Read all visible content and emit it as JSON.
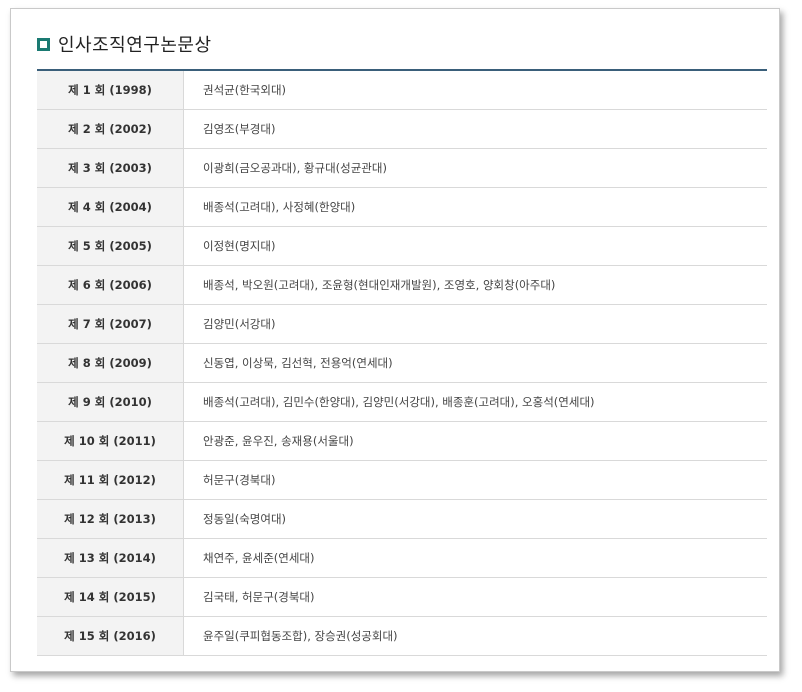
{
  "title": "인사조직연구논문상",
  "rows": [
    {
      "round": "제 1 회 (1998)",
      "winners": "권석균(한국외대)"
    },
    {
      "round": "제 2 회 (2002)",
      "winners": "김영조(부경대)"
    },
    {
      "round": "제 3 회 (2003)",
      "winners": "이광희(금오공과대), 황규대(성균관대)"
    },
    {
      "round": "제 4 회 (2004)",
      "winners": "배종석(고려대), 사정혜(한양대)"
    },
    {
      "round": "제 5 회 (2005)",
      "winners": "이정현(명지대)"
    },
    {
      "round": "제 6 회 (2006)",
      "winners": "배종석, 박오원(고려대), 조윤형(현대인재개발원), 조영호, 양회창(아주대)"
    },
    {
      "round": "제 7 회 (2007)",
      "winners": "김양민(서강대)"
    },
    {
      "round": "제 8 회 (2009)",
      "winners": "신동엽, 이상묵, 김선혁, 전용억(연세대)"
    },
    {
      "round": "제 9 회 (2010)",
      "winners": "배종석(고려대), 김민수(한양대), 김양민(서강대), 배종훈(고려대), 오홍석(연세대)"
    },
    {
      "round": "제 10 회 (2011)",
      "winners": "안광준, 윤우진, 송재용(서울대)"
    },
    {
      "round": "제 11 회 (2012)",
      "winners": "허문구(경북대)"
    },
    {
      "round": "제 12 회 (2013)",
      "winners": "정동일(숙명여대)"
    },
    {
      "round": "제 13 회 (2014)",
      "winners": "채연주, 윤세준(연세대)"
    },
    {
      "round": "제 14 회 (2015)",
      "winners": "김국태, 허문구(경북대)"
    },
    {
      "round": "제 15 회 (2016)",
      "winners": "윤주일(쿠피협동조합), 장승권(성공회대)"
    }
  ]
}
